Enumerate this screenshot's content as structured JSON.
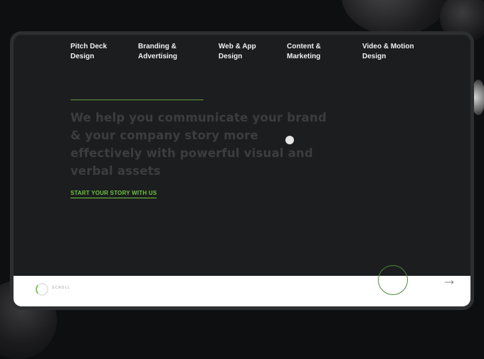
{
  "nav": {
    "items": [
      {
        "line1": "Pitch Deck",
        "line2": "Design"
      },
      {
        "line1": "Branding &",
        "line2": "Advertising"
      },
      {
        "line1": "Web & App",
        "line2": "Design"
      },
      {
        "line1": "Content &",
        "line2": "Marketing"
      },
      {
        "line1": "Video & Motion",
        "line2": "Design"
      }
    ]
  },
  "hero": {
    "headline": "We help you communicate your brand & your company story more effectively with powerful visual and verbal assets",
    "cta_label": "START YOUR STORY WITH US"
  },
  "footer": {
    "scroll_label": "SCROLL"
  },
  "colors": {
    "accent": "#6bc43e",
    "background": "#1c1d1f"
  },
  "icons": [
    "scroll-indicator-icon",
    "arrow-right-icon",
    "cursor-dot-icon"
  ]
}
